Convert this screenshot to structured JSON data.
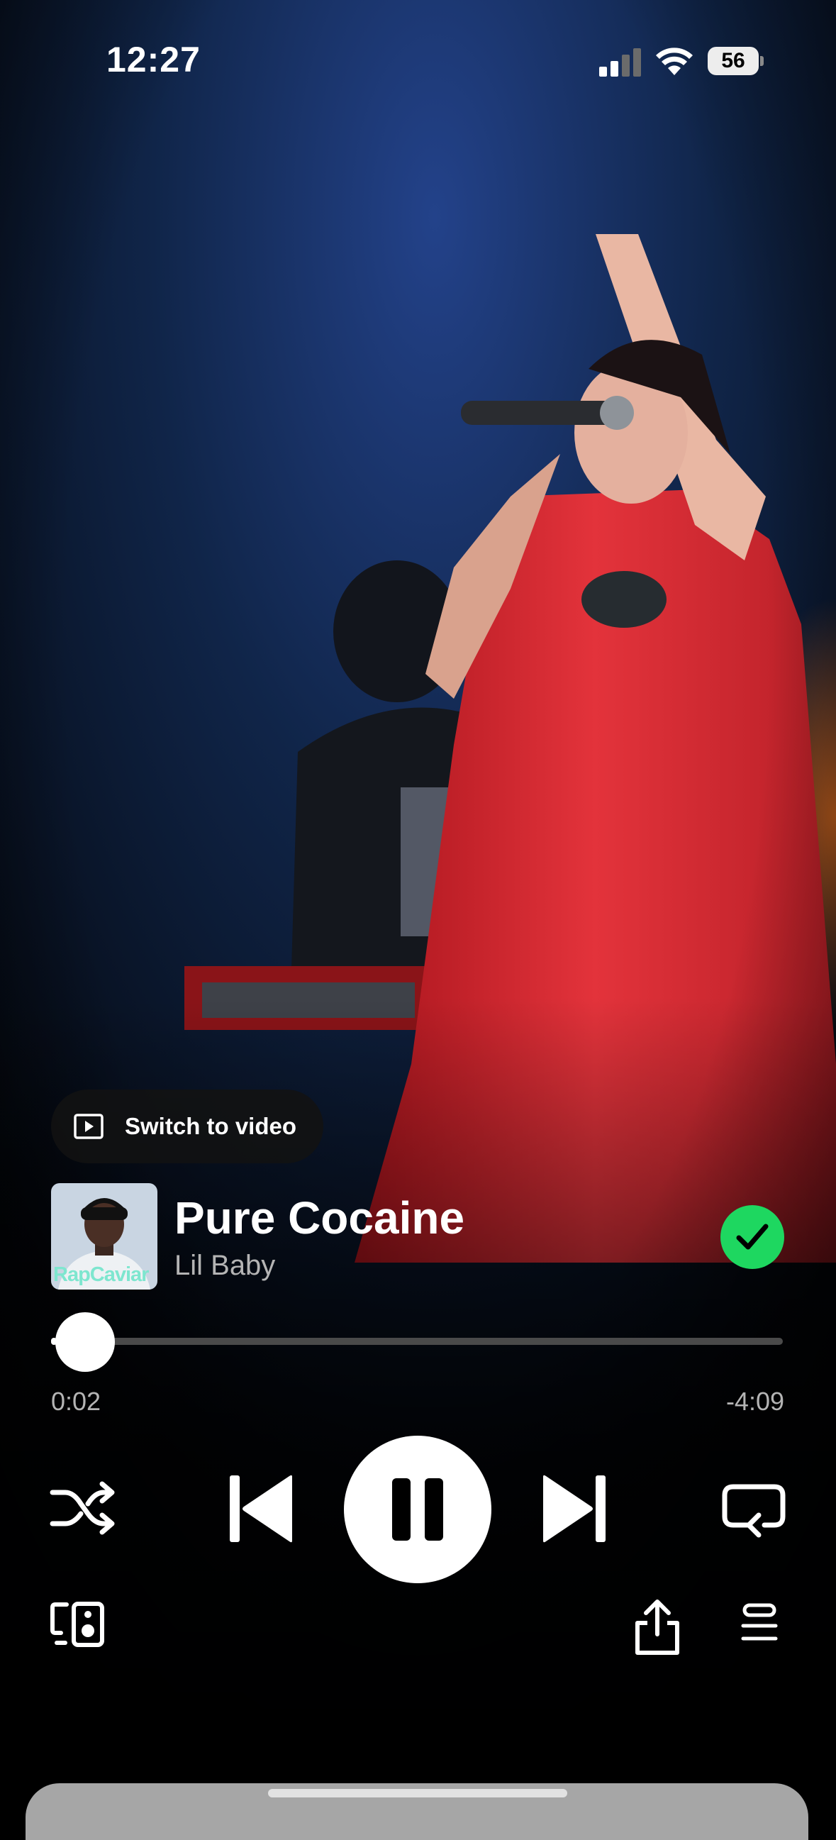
{
  "status_bar": {
    "time": "12:27",
    "battery": "56"
  },
  "player": {
    "switch_video_label": "Switch to video",
    "cover_label": "RapCaviar",
    "track_title": "Pure Cocaine",
    "artist": "Lil Baby",
    "liked": true,
    "elapsed": "0:02",
    "remaining": "-4:09",
    "progress_fraction": 0.008,
    "state": "playing"
  },
  "icons": {
    "switch_video": "play-box-icon",
    "liked": "check-icon",
    "shuffle": "shuffle-icon",
    "previous": "skip-previous-icon",
    "play_pause": "pause-icon",
    "next": "skip-next-icon",
    "repeat": "repeat-icon",
    "devices": "connect-devices-icon",
    "share": "share-icon",
    "queue": "queue-icon"
  },
  "colors": {
    "accent": "#1ed760",
    "background": "#000000",
    "secondary_text": "#b4b4b4"
  }
}
